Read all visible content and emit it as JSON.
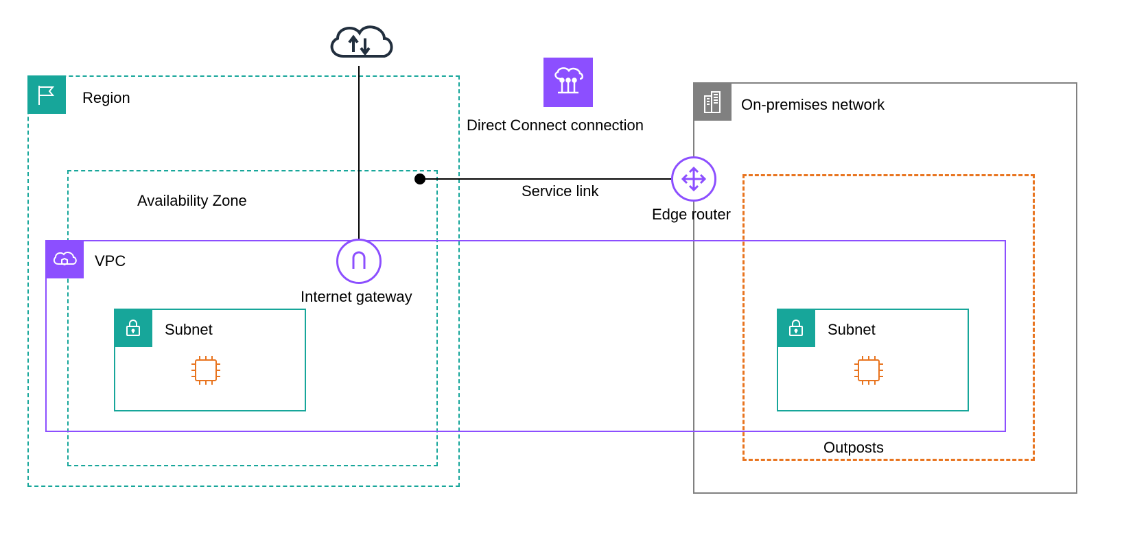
{
  "colors": {
    "teal": "#17A69A",
    "purple": "#8C4FFF",
    "purpleFill": "#8C4FFF",
    "orange": "#E8741F",
    "grey": "#808080",
    "dark": "#222F3E"
  },
  "region": {
    "label": "Region"
  },
  "az": {
    "label": "Availability Zone"
  },
  "vpc": {
    "label": "VPC"
  },
  "igw": {
    "label": "Internet gateway"
  },
  "subnet1": {
    "label": "Subnet"
  },
  "subnet2": {
    "label": "Subnet"
  },
  "onprem": {
    "label": "On-premises network"
  },
  "outposts": {
    "label": "Outposts"
  },
  "dx": {
    "label": "Direct Connect connection"
  },
  "serviceLink": {
    "label": "Service link"
  },
  "edgeRouter": {
    "label": "Edge router"
  }
}
